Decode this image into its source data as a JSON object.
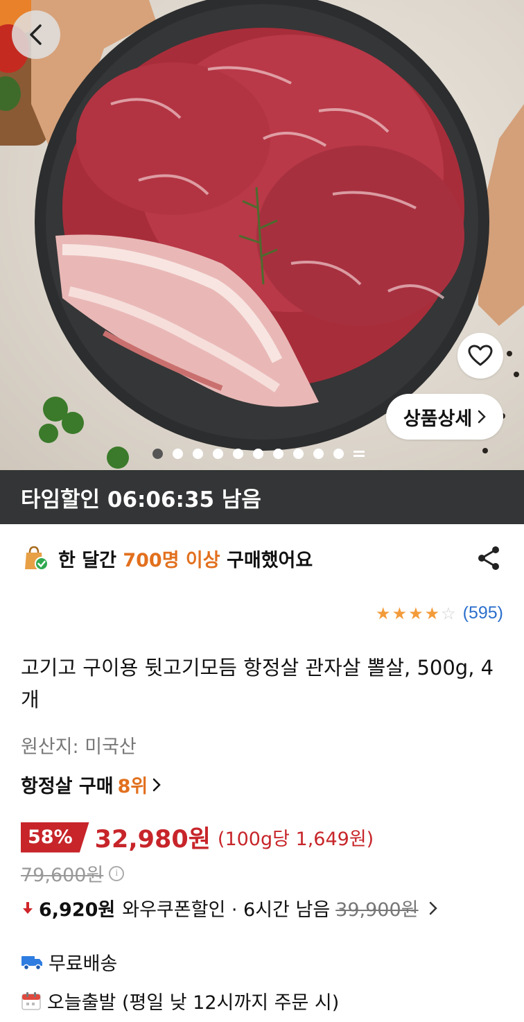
{
  "timer": {
    "text": "타임할인 06:06:35 남음"
  },
  "hero": {
    "detail_button_label": "상품상세",
    "slide_count": 10,
    "active_slide": 1
  },
  "purchase": {
    "prefix": "한 달간",
    "highlight": "700명 이상",
    "suffix": "구매했어요",
    "highlight_color": "#e2701e"
  },
  "rating": {
    "stars": 4,
    "max_stars": 5,
    "review_count": "(595)"
  },
  "product": {
    "title": "고기고 구이용 뒷고기모듬 항정살 관자살 뽈살, 500g, 4개",
    "origin": "원산지: 미국산",
    "rank_category": "항정살 구매",
    "rank_value": "8위"
  },
  "price": {
    "discount_rate": "58%",
    "sale_price": "32,980원",
    "unit_price": "(100g당 1,649원)",
    "original_price": "79,600원",
    "accent_color": "#c7252a"
  },
  "coupon": {
    "amount": "6,920원",
    "label": "와우쿠폰할인 · 6시간 남음",
    "original": "39,900원"
  },
  "shipping": {
    "free_label": "무료배송",
    "depart_label": "오늘출발 (평일 낮 12시까지 주문 시)"
  },
  "icons": {
    "back": "chevron-left-icon",
    "heart": "heart-icon",
    "share": "share-icon",
    "bag": "shopping-bag-check-icon",
    "truck": "truck-icon",
    "calendar": "calendar-icon",
    "info": "info-icon",
    "arrow_down": "arrow-down-icon"
  }
}
